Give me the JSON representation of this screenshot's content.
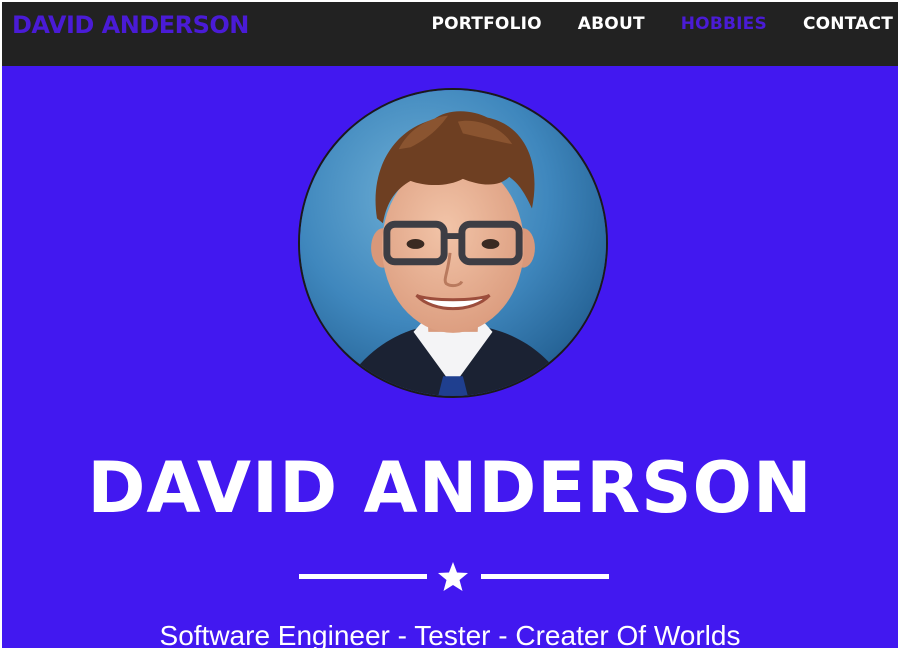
{
  "navbar": {
    "brand": "DAVID ANDERSON",
    "links": [
      {
        "label": "PORTFOLIO",
        "active": false
      },
      {
        "label": "ABOUT",
        "active": false
      },
      {
        "label": "HOBBIES",
        "active": true
      },
      {
        "label": "CONTACT",
        "active": false
      }
    ]
  },
  "hero": {
    "name": "DAVID ANDERSON",
    "tagline": "Software Engineer - Tester - Creater Of Worlds"
  },
  "icons": {
    "divider": "star-icon",
    "avatar": "profile-photo"
  },
  "colors": {
    "navbar_bg": "#222222",
    "brand": "#4a1bd6",
    "active_link": "#4a1bd6",
    "hero_bg": "#4218f0",
    "text": "#ffffff"
  }
}
